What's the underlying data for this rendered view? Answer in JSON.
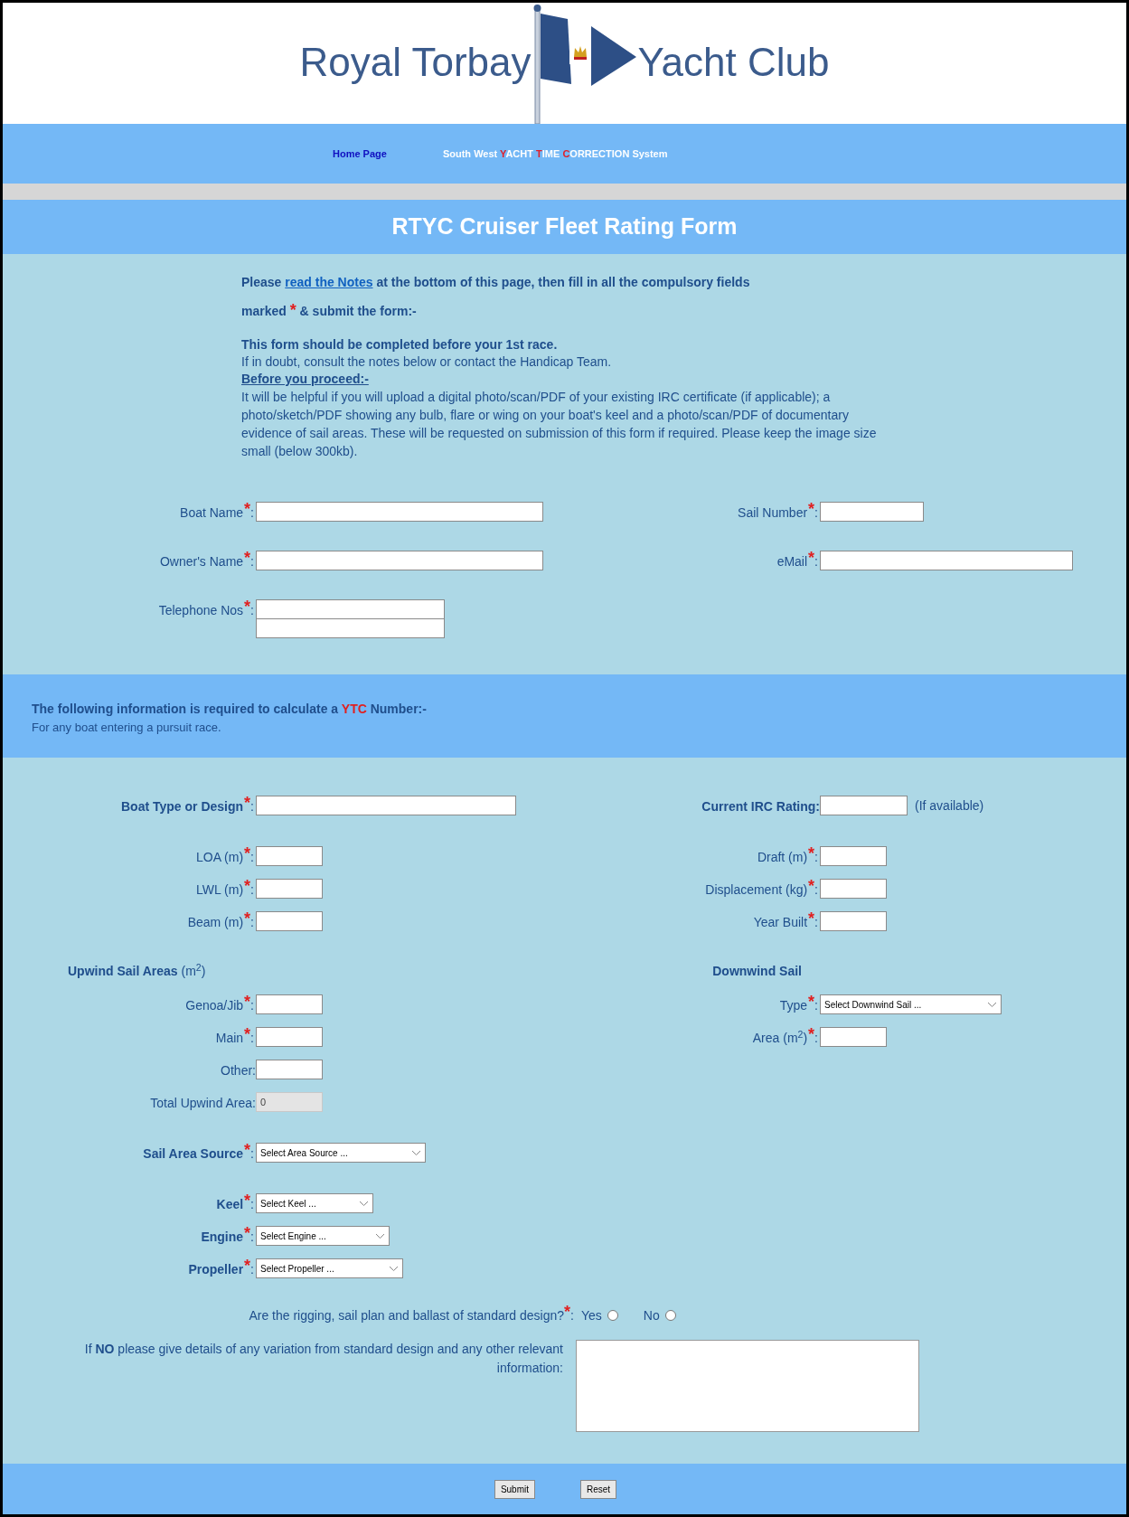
{
  "header": {
    "title_left": "Royal Torbay",
    "title_right": "Yacht Club"
  },
  "nav": {
    "links": [
      {
        "segments": [
          {
            "text": "Home Page",
            "highlight": false
          }
        ],
        "kind": "home"
      },
      {
        "segments": [
          {
            "text": "South West ",
            "highlight": false
          },
          {
            "text": "Y",
            "highlight": true
          },
          {
            "text": "ACHT ",
            "highlight": false
          },
          {
            "text": "T",
            "highlight": true
          },
          {
            "text": "IME ",
            "highlight": false
          },
          {
            "text": "C",
            "highlight": true
          },
          {
            "text": "ORRECTION System",
            "highlight": false
          }
        ],
        "kind": "system"
      }
    ]
  },
  "form_title": "RTYC Cruiser Fleet Rating Form",
  "intro": {
    "before_link": "Please ",
    "link": "read the Notes",
    "after_link": " at the bottom of this page, then fill in all the compulsory fields marked",
    "mark": "*",
    "end": "& submit the form:-",
    "bold_line": "This form should be completed before your 1st race.",
    "line": "If in doubt, consult the notes below or contact the Handicap Team.",
    "subheading": "Before you proceed:-",
    "paragraph": "It will be helpful if you will upload a digital photo/scan/PDF of your existing IRC certificate (if applicable); a photo/sketch/PDF showing any bulb, flare or wing on your boat's keel and a photo/scan/PDF of documentary evidence of sail areas. These will be requested on submission of this form if required. Please keep the image size small (below 300kb)."
  },
  "contact_rows": [
    {
      "left": {
        "kind": "text",
        "label": "Boat Name",
        "mark": "*",
        "suffix": ":",
        "bold": false
      },
      "right": {
        "kind": "text",
        "label": "Sail Number",
        "mark": "*",
        "suffix": ":",
        "bold": false
      }
    },
    {
      "left": {
        "kind": "text",
        "label": "Owner's Name",
        "mark": "*",
        "suffix": ":",
        "bold": false
      },
      "right": {
        "kind": "text",
        "label": "eMail",
        "mark": "*",
        "suffix": ":",
        "bold": false
      }
    },
    {
      "left": {
        "kind": "double",
        "label": "Telephone Nos",
        "mark": "*",
        "suffix": ":",
        "bold": false
      }
    }
  ],
  "band": {
    "segments": [
      {
        "text": "The following information is required to calculate a ",
        "highlight": false
      },
      {
        "text": "YTC",
        "highlight": true
      },
      {
        "text": " Number:-",
        "highlight": false
      }
    ],
    "sub": "For any boat entering a pursuit race."
  },
  "groups": [
    [
      {
        "left": {
          "kind": "text",
          "label": "Boat Type or Design",
          "mark": "*",
          "suffix": ":",
          "bold": true
        },
        "right": {
          "kind": "text",
          "label": "Current IRC Rating:",
          "bold": true,
          "note": "(If available)"
        }
      }
    ],
    [
      {
        "left": {
          "kind": "text",
          "label": "LOA (m)",
          "mark": "*",
          "suffix": ":",
          "bold": false
        },
        "right": {
          "kind": "text",
          "label": "Draft (m)",
          "mark": "*",
          "suffix": ":",
          "bold": false
        }
      },
      {
        "left": {
          "kind": "text",
          "label": "LWL (m)",
          "mark": "*",
          "suffix": ":",
          "bold": false
        },
        "right": {
          "kind": "text",
          "label": "Displacement (kg)",
          "mark": "*",
          "suffix": ":",
          "bold": false
        }
      },
      {
        "left": {
          "kind": "text",
          "label": "Beam (m)",
          "mark": "*",
          "suffix": ":",
          "bold": false
        },
        "right": {
          "kind": "text",
          "label": "Year Built",
          "mark": "*",
          "suffix": ":",
          "bold": false
        }
      }
    ],
    [
      {
        "left": {
          "kind": "heading",
          "label": "**Upwind Sail Areas** (m$^{2}$)"
        },
        "right": {
          "kind": "heading",
          "label": "**Downwind Sail**"
        }
      },
      {
        "left": {
          "kind": "text",
          "label": "Genoa/Jib",
          "mark": "*",
          "suffix": ":",
          "bold": false
        },
        "right": {
          "kind": "select",
          "label": "Type ",
          "mark": "*",
          "suffix": ":",
          "value": "Select Downwind Sail ...",
          "bold": false
        }
      },
      {
        "left": {
          "kind": "text",
          "label": "Main",
          "mark": "*",
          "suffix": ":",
          "bold": false
        },
        "right": {
          "kind": "text",
          "label": "Area (m$^{2}$)",
          "mark": "*",
          "suffix": ":",
          "bold": false
        }
      },
      {
        "left": {
          "kind": "text",
          "label": "Other:",
          "bold": false
        }
      },
      {
        "left": {
          "kind": "readonly",
          "label": "Total Upwind Area:",
          "value": "0",
          "bold": false
        }
      }
    ],
    [
      {
        "left": {
          "kind": "select",
          "label": "Sail Area Source",
          "mark": "*",
          "suffix": ":",
          "value": "Select Area Source ...",
          "bold": true
        }
      }
    ],
    [
      {
        "left": {
          "kind": "select",
          "label": "Keel",
          "mark": "*",
          "suffix": ":",
          "value": "Select Keel ...",
          "bold": true
        }
      },
      {
        "left": {
          "kind": "select",
          "label": "Engine",
          "mark": "*",
          "suffix": ":",
          "value": "Select Engine ...",
          "bold": true
        }
      },
      {
        "left": {
          "kind": "select",
          "label": "Propeller",
          "mark": "*",
          "suffix": ":",
          "value": "Select Propeller ...",
          "bold": true
        }
      }
    ]
  ],
  "standard_design": {
    "question": "Are the rigging, sail plan and ballast of standard design?",
    "mark": "*",
    "suffix": ":",
    "options": [
      {
        "label": "Yes",
        "selected": false
      },
      {
        "label": "No",
        "selected": false
      }
    ]
  },
  "details": {
    "label": "If **NO** please give details of any variation from standard design and any other relevant information:"
  },
  "buttons": [
    {
      "label": "Submit"
    },
    {
      "label": "Reset"
    }
  ]
}
